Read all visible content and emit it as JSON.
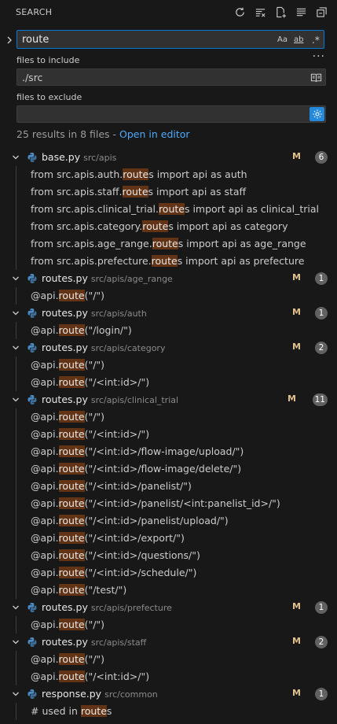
{
  "header": {
    "title": "SEARCH"
  },
  "search": {
    "value": "route",
    "opt_case": "Aa",
    "opt_word": "ab",
    "opt_regex": ".*"
  },
  "include": {
    "label": "files to include",
    "value": "./src"
  },
  "exclude": {
    "label": "files to exclude",
    "value": ""
  },
  "more_label": "···",
  "summary": {
    "text": "25 results in 8 files - ",
    "link": "Open in editor"
  },
  "colors": {
    "accent": "#0078d4",
    "match_highlight": "#623315",
    "modified": "#e2c08d",
    "link": "#4daafc"
  },
  "files": [
    {
      "name": "base.py",
      "path": "src/apis",
      "status": "M",
      "count": "6",
      "matches": [
        {
          "pre": "from src.apis.auth.",
          "hit": "route",
          "post": "s import api as auth"
        },
        {
          "pre": "from src.apis.staff.",
          "hit": "route",
          "post": "s import api as staff"
        },
        {
          "pre": "from src.apis.clinical_trial.",
          "hit": "route",
          "post": "s import api as clinical_trial"
        },
        {
          "pre": "from src.apis.category.",
          "hit": "route",
          "post": "s import api as category"
        },
        {
          "pre": "from src.apis.age_range.",
          "hit": "route",
          "post": "s import api as age_range"
        },
        {
          "pre": "from src.apis.prefecture.",
          "hit": "route",
          "post": "s import api as prefecture"
        }
      ]
    },
    {
      "name": "routes.py",
      "path": "src/apis/age_range",
      "status": "M",
      "count": "1",
      "matches": [
        {
          "pre": "@api.",
          "hit": "route",
          "post": "(\"/\")"
        }
      ]
    },
    {
      "name": "routes.py",
      "path": "src/apis/auth",
      "status": "M",
      "count": "1",
      "matches": [
        {
          "pre": "@api.",
          "hit": "route",
          "post": "(\"/login/\")"
        }
      ]
    },
    {
      "name": "routes.py",
      "path": "src/apis/category",
      "status": "M",
      "count": "2",
      "matches": [
        {
          "pre": "@api.",
          "hit": "route",
          "post": "(\"/\")"
        },
        {
          "pre": "@api.",
          "hit": "route",
          "post": "(\"/<int:id>/\")"
        }
      ]
    },
    {
      "name": "routes.py",
      "path": "src/apis/clinical_trial",
      "status": "M",
      "count": "11",
      "matches": [
        {
          "pre": "@api.",
          "hit": "route",
          "post": "(\"/\")"
        },
        {
          "pre": "@api.",
          "hit": "route",
          "post": "(\"/<int:id>/\")"
        },
        {
          "pre": "@api.",
          "hit": "route",
          "post": "(\"/<int:id>/flow-image/upload/\")"
        },
        {
          "pre": "@api.",
          "hit": "route",
          "post": "(\"/<int:id>/flow-image/delete/\")"
        },
        {
          "pre": "@api.",
          "hit": "route",
          "post": "(\"/<int:id>/panelist/\")"
        },
        {
          "pre": "@api.",
          "hit": "route",
          "post": "(\"/<int:id>/panelist/<int:panelist_id>/\")"
        },
        {
          "pre": "@api.",
          "hit": "route",
          "post": "(\"/<int:id>/panelist/upload/\")"
        },
        {
          "pre": "@api.",
          "hit": "route",
          "post": "(\"/<int:id>/export/\")"
        },
        {
          "pre": "@api.",
          "hit": "route",
          "post": "(\"/<int:id>/questions/\")"
        },
        {
          "pre": "@api.",
          "hit": "route",
          "post": "(\"/<int:id>/schedule/\")"
        },
        {
          "pre": "@api.",
          "hit": "route",
          "post": "(\"/test/\")"
        }
      ]
    },
    {
      "name": "routes.py",
      "path": "src/apis/prefecture",
      "status": "M",
      "count": "1",
      "matches": [
        {
          "pre": "@api.",
          "hit": "route",
          "post": "(\"/\")"
        }
      ]
    },
    {
      "name": "routes.py",
      "path": "src/apis/staff",
      "status": "M",
      "count": "2",
      "matches": [
        {
          "pre": "@api.",
          "hit": "route",
          "post": "(\"/\")"
        },
        {
          "pre": "@api.",
          "hit": "route",
          "post": "(\"/<int:id>/\")"
        }
      ]
    },
    {
      "name": "response.py",
      "path": "src/common",
      "status": "M",
      "count": "1",
      "matches": [
        {
          "pre": "# used in ",
          "hit": "route",
          "post": "s"
        }
      ]
    }
  ]
}
